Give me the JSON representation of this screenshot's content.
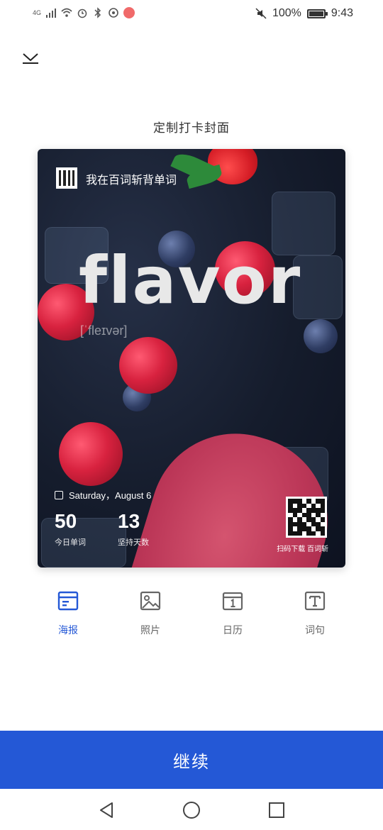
{
  "status_bar": {
    "network": "4G",
    "battery_percent": "100%",
    "battery_level": 1.0,
    "time": "9:43",
    "icons": [
      "signal-icon",
      "wifi-icon",
      "alarm-icon",
      "bluetooth-icon",
      "data-saver-icon",
      "app-notification-icon",
      "mute-icon",
      "battery-icon"
    ]
  },
  "header": {
    "close_icon": "chevron-down-icon",
    "title": "定制打卡封面"
  },
  "poster": {
    "brand": "我在百词斩背单词",
    "word": "flavor",
    "phonetic": "[ˈfleɪvər]",
    "date": "Saturday，August 6",
    "stats": [
      {
        "value": "50",
        "label": "今日单词"
      },
      {
        "value": "13",
        "label": "坚持天数"
      }
    ],
    "qr_label": "扫码下载 百词斩"
  },
  "tabs": [
    {
      "label": "海报",
      "icon": "poster-icon",
      "active": true
    },
    {
      "label": "照片",
      "icon": "photo-icon",
      "active": false
    },
    {
      "label": "日历",
      "icon": "calendar-icon",
      "active": false
    },
    {
      "label": "词句",
      "icon": "text-icon",
      "active": false
    }
  ],
  "continue_label": "继续",
  "colors": {
    "accent": "#2458d6",
    "tab_inactive": "#666666"
  },
  "navbar": {
    "icons": [
      "back-icon",
      "home-icon",
      "recents-icon"
    ]
  }
}
